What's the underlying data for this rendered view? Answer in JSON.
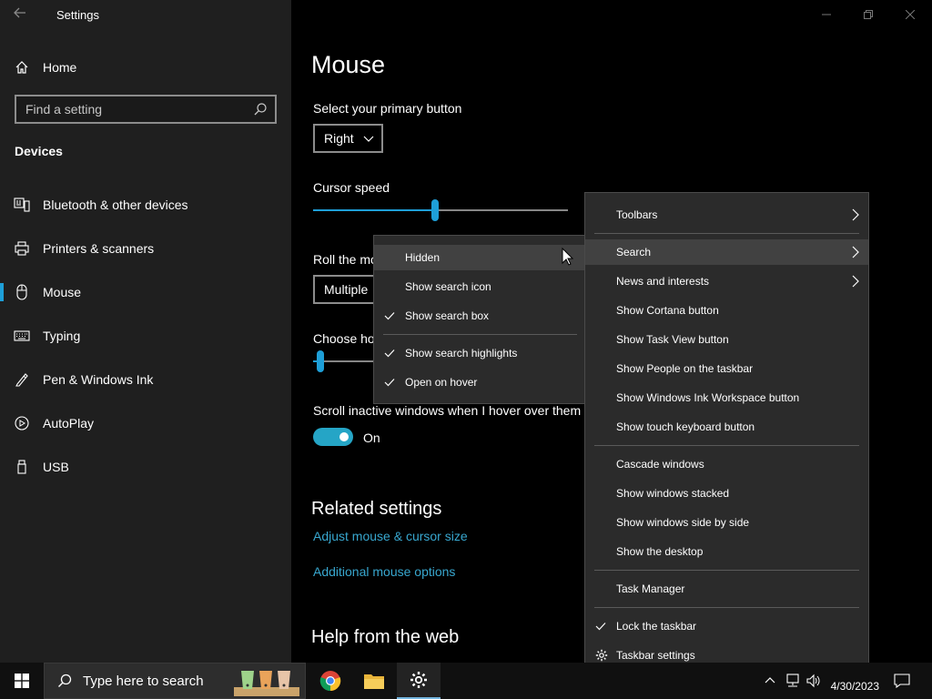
{
  "window": {
    "title": "Settings"
  },
  "sidebar": {
    "home_label": "Home",
    "search_placeholder": "Find a setting",
    "section_label": "Devices",
    "items": [
      {
        "label": "Bluetooth & other devices",
        "icon": "bluetooth-devices-icon"
      },
      {
        "label": "Printers & scanners",
        "icon": "printer-icon"
      },
      {
        "label": "Mouse",
        "icon": "mouse-icon",
        "active": true
      },
      {
        "label": "Typing",
        "icon": "keyboard-icon"
      },
      {
        "label": "Pen & Windows Ink",
        "icon": "pen-icon"
      },
      {
        "label": "AutoPlay",
        "icon": "autoplay-icon"
      },
      {
        "label": "USB",
        "icon": "usb-icon"
      }
    ]
  },
  "main": {
    "title": "Mouse",
    "primary_button_label": "Select your primary button",
    "primary_button_value": "Right",
    "cursor_speed_label": "Cursor speed",
    "cursor_speed_percent": 48,
    "roll_label": "Roll the mo",
    "roll_value": "Multiple",
    "choose_label": "Choose ho",
    "choose_percent": 3,
    "scroll_inactive_label": "Scroll inactive windows when I hover over them",
    "scroll_inactive_state": "On",
    "related_heading": "Related settings",
    "links": [
      "Adjust mouse & cursor size",
      "Additional mouse options"
    ],
    "help_heading": "Help from the web"
  },
  "taskbar_menu": {
    "items": [
      {
        "label": "Toolbars",
        "submenu": true
      },
      {
        "label": "Search",
        "submenu": true,
        "highlighted": true
      },
      {
        "label": "News and interests",
        "submenu": true
      },
      {
        "label": "Show Cortana button"
      },
      {
        "label": "Show Task View button"
      },
      {
        "label": "Show People on the taskbar"
      },
      {
        "label": "Show Windows Ink Workspace button"
      },
      {
        "label": "Show touch keyboard button"
      },
      {
        "label": "Cascade windows"
      },
      {
        "label": "Show windows stacked"
      },
      {
        "label": "Show windows side by side"
      },
      {
        "label": "Show the desktop"
      },
      {
        "label": "Task Manager"
      },
      {
        "label": "Lock the taskbar",
        "checked": true
      },
      {
        "label": "Taskbar settings",
        "icon": "gear-icon"
      }
    ]
  },
  "search_submenu": {
    "items": [
      {
        "label": "Hidden",
        "highlighted": true
      },
      {
        "label": "Show search icon"
      },
      {
        "label": "Show search box",
        "checked": true
      },
      {
        "label": "Show search highlights",
        "checked": true
      },
      {
        "label": "Open on hover",
        "checked": true
      }
    ]
  },
  "taskbar": {
    "search_placeholder": "Type here to search",
    "date": "4/30/2023",
    "accent": "#1e9fd8"
  }
}
